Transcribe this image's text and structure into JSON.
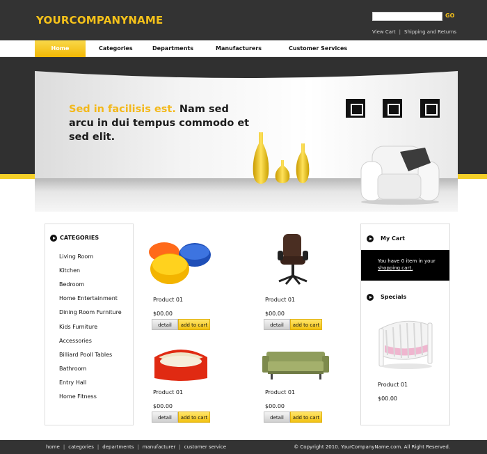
{
  "header": {
    "logo": "YOURCOMPANYNAME",
    "search": {
      "value": "",
      "placeholder": ""
    },
    "go_label": "GO",
    "links": [
      "View Cart",
      "Shipping and Returns"
    ],
    "link_separator": "|"
  },
  "nav": [
    "Home",
    "Categories",
    "Departments",
    "Manufacturers",
    "Customer Services"
  ],
  "hero": {
    "highlight": "Sed in facilisis est.",
    "text": "Nam sed arcu in dui tempus commodo et sed elit."
  },
  "categories": {
    "title": "CATEGORIES",
    "items": [
      "Living Room",
      "Kitchen",
      "Bedroom",
      "Home Entertainment",
      "Dining Room Furniture",
      "Kids Furniture",
      "Accessories",
      "Billiard Pooll Tables",
      "Bathroom",
      "Entry Hall",
      "Home Fitness"
    ]
  },
  "products": [
    {
      "name": "Product 01",
      "price": "$00.00",
      "image": "ottoman-cushions"
    },
    {
      "name": "Product 01",
      "price": "$00.00",
      "image": "office-chair"
    },
    {
      "name": "Product 01",
      "price": "$00.00",
      "image": "red-loveseat"
    },
    {
      "name": "Product 01",
      "price": "$00.00",
      "image": "green-sofa"
    }
  ],
  "buttons": {
    "detail": "detail",
    "add_to_cart": "add to cart"
  },
  "sidebar": {
    "cart_title": "My Cart",
    "cart_text": "You have 0 item in your",
    "cart_link": "shopping cart.",
    "specials_title": "Specials",
    "special": {
      "name": "Product 01",
      "price": "$00.00",
      "image": "baby-crib"
    }
  },
  "footer": {
    "links": [
      "home",
      "categories",
      "departments",
      "manufacturer",
      "customer service"
    ],
    "separator": "|",
    "copyright": "© Copyright 2010. YourCompanyName.com. All Right Reserved."
  },
  "colors": {
    "accent": "#f6c21a",
    "header_bg": "#333333",
    "footer_bg": "#333333"
  }
}
